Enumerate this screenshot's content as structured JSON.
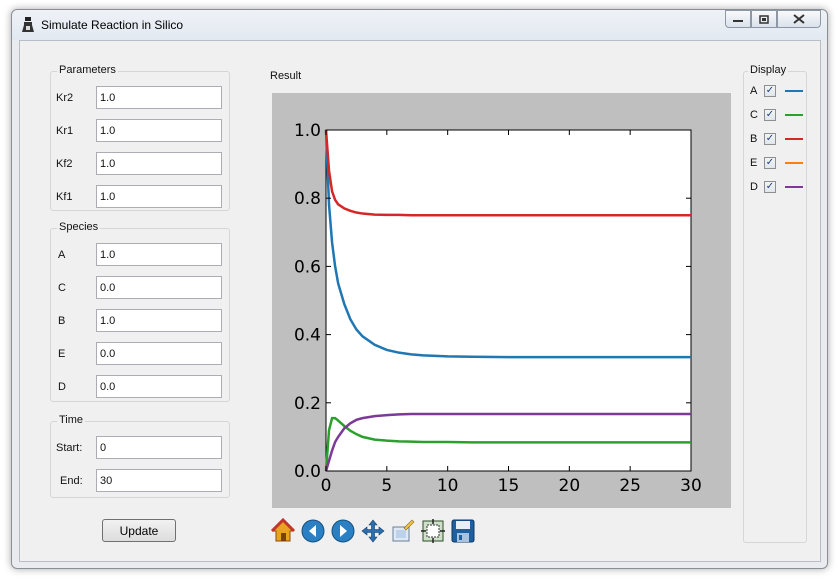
{
  "window": {
    "title": "Simulate Reaction in Silico"
  },
  "parameters": {
    "title": "Parameters",
    "rows": [
      {
        "label": "Kr2",
        "value": "1.0"
      },
      {
        "label": "Kr1",
        "value": "1.0"
      },
      {
        "label": "Kf2",
        "value": "1.0"
      },
      {
        "label": "Kf1",
        "value": "1.0"
      }
    ]
  },
  "species": {
    "title": "Species",
    "rows": [
      {
        "label": "A",
        "value": "1.0"
      },
      {
        "label": "C",
        "value": "0.0"
      },
      {
        "label": "B",
        "value": "1.0"
      },
      {
        "label": "E",
        "value": "0.0"
      },
      {
        "label": "D",
        "value": "0.0"
      }
    ]
  },
  "time": {
    "title": "Time",
    "rows": [
      {
        "label": "Start:",
        "value": "0"
      },
      {
        "label": "End:",
        "value": "30"
      }
    ]
  },
  "update_label": "Update",
  "result_title": "Result",
  "display": {
    "title": "Display",
    "rows": [
      {
        "label": "A",
        "checked": true,
        "color": "#1f77b4"
      },
      {
        "label": "C",
        "checked": true,
        "color": "#2ca02c"
      },
      {
        "label": "B",
        "checked": true,
        "color": "#d62728"
      },
      {
        "label": "E",
        "checked": true,
        "color": "#ff7f0e"
      },
      {
        "label": "D",
        "checked": true,
        "color": "#7b3a96"
      }
    ]
  },
  "toolbar": {
    "icons": [
      "home-icon",
      "back-icon",
      "forward-icon",
      "pan-icon",
      "configure-subplots-icon",
      "zoom-rect-icon",
      "save-icon"
    ]
  },
  "chart_data": {
    "type": "line",
    "xlim": [
      0,
      30
    ],
    "ylim": [
      0,
      1.0
    ],
    "xticks": [
      "0",
      "5",
      "10",
      "15",
      "20",
      "25",
      "30"
    ],
    "yticks": [
      "0.0",
      "0.2",
      "0.4",
      "0.6",
      "0.8",
      "1.0"
    ],
    "grid": false,
    "series": [
      {
        "name": "A",
        "color": "#1f77b4",
        "x": [
          0,
          0.25,
          0.5,
          0.75,
          1,
          1.5,
          2,
          2.5,
          3,
          4,
          5,
          6,
          7,
          8,
          10,
          12,
          15,
          20,
          25,
          30
        ],
        "y": [
          1.0,
          0.78,
          0.67,
          0.6,
          0.55,
          0.49,
          0.445,
          0.415,
          0.395,
          0.37,
          0.355,
          0.347,
          0.342,
          0.339,
          0.336,
          0.335,
          0.334,
          0.334,
          0.334,
          0.334
        ]
      },
      {
        "name": "C",
        "color": "#2ca02c",
        "x": [
          0,
          0.25,
          0.5,
          0.75,
          1,
          1.5,
          2,
          2.5,
          3,
          4,
          5,
          6,
          7,
          8,
          10,
          12,
          15,
          20,
          25,
          30
        ],
        "y": [
          0.0,
          0.12,
          0.155,
          0.155,
          0.148,
          0.132,
          0.118,
          0.108,
          0.1,
          0.092,
          0.089,
          0.087,
          0.086,
          0.085,
          0.085,
          0.084,
          0.084,
          0.084,
          0.084,
          0.084
        ]
      },
      {
        "name": "B",
        "color": "#d62728",
        "x": [
          0,
          0.25,
          0.5,
          0.75,
          1,
          1.5,
          2,
          2.5,
          3,
          4,
          5,
          6,
          7,
          8,
          10,
          12,
          15,
          20,
          25,
          30
        ],
        "y": [
          1.0,
          0.88,
          0.82,
          0.795,
          0.782,
          0.77,
          0.763,
          0.758,
          0.755,
          0.752,
          0.751,
          0.751,
          0.75,
          0.75,
          0.75,
          0.75,
          0.75,
          0.75,
          0.75,
          0.75
        ]
      },
      {
        "name": "D",
        "color": "#7b3a96",
        "x": [
          0,
          0.25,
          0.5,
          0.75,
          1,
          1.5,
          2,
          2.5,
          3,
          4,
          5,
          6,
          7,
          8,
          10,
          12,
          15,
          20,
          25,
          30
        ],
        "y": [
          0.0,
          0.03,
          0.06,
          0.085,
          0.1,
          0.125,
          0.14,
          0.15,
          0.155,
          0.161,
          0.164,
          0.166,
          0.167,
          0.167,
          0.167,
          0.167,
          0.167,
          0.167,
          0.167,
          0.167
        ]
      }
    ]
  }
}
